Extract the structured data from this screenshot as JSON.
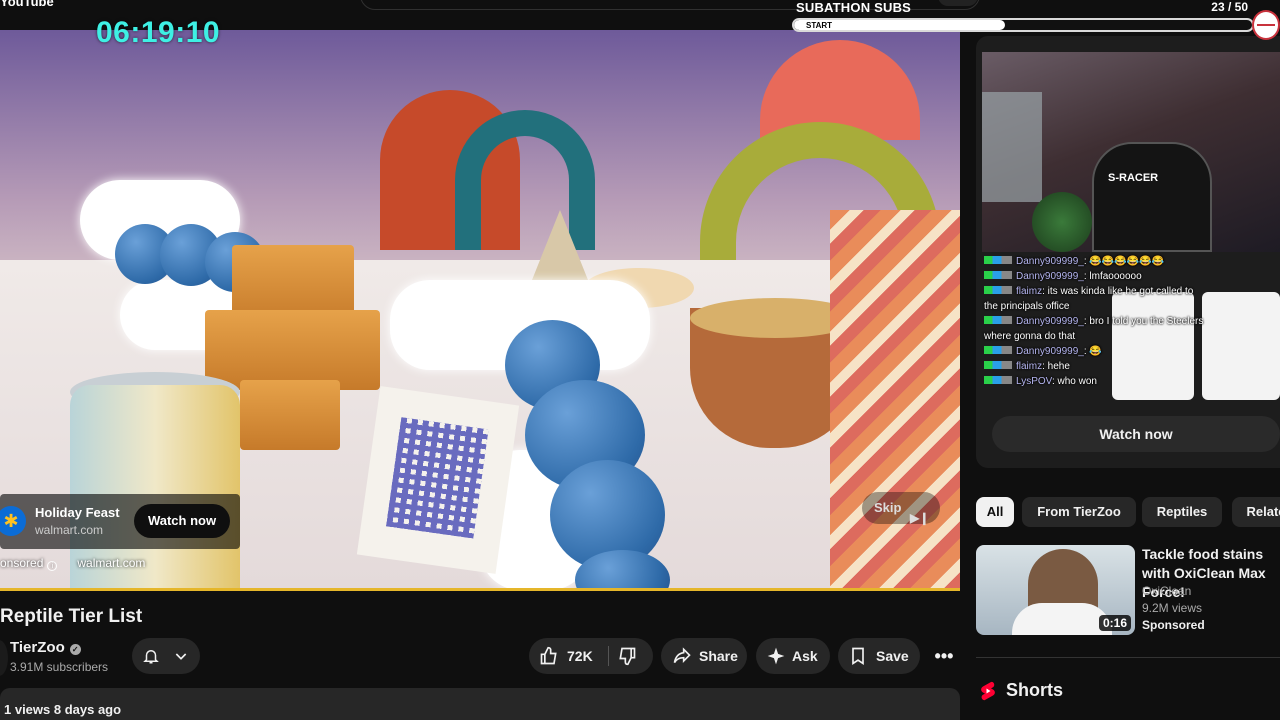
{
  "top": {
    "logo_text": "YouTube"
  },
  "overlay": {
    "timer": "06:19:10",
    "subathon_label": "SUBATHON SUBS",
    "start_label": "START",
    "count": "23  / 50",
    "progress_fraction": 0.46
  },
  "ad": {
    "title": "Holiday Feast",
    "domain": "walmart.com",
    "watch_label": "Watch now",
    "sponsored_label": "onsored",
    "sponsored_domain": "walmart.com",
    "skip_label": "Skip"
  },
  "video": {
    "title": "Reptile Tier List",
    "channel": "TierZoo",
    "subscribers": "3.91M subscribers",
    "likes": "72K",
    "share_label": "Share",
    "ask_label": "Ask",
    "save_label": "Save",
    "views_line": "1 views  8 days ago"
  },
  "live": {
    "cam_label": "S-RACER",
    "chat": [
      {
        "user": "Danny909999_",
        "msg": ": 😂😂😂😂😂😂"
      },
      {
        "user": "Danny909999_",
        "msg": ": lmfaoooooo"
      },
      {
        "user": "flaimz",
        "msg": ": its was kinda like he got called to the principals office"
      },
      {
        "user": "Danny909999_",
        "msg": ": bro I told you the Steelers where gonna do that"
      },
      {
        "user": "Danny909999_",
        "msg": ": 😂"
      },
      {
        "user": "flaimz",
        "msg": ": hehe"
      },
      {
        "user": "LysPOV",
        "msg": ": who won"
      }
    ],
    "watch_now": "Watch now"
  },
  "chips": [
    "All",
    "From TierZoo",
    "Reptiles",
    "Related"
  ],
  "recommendation": {
    "title": "Tackle food stains with OxiClean Max Force!",
    "channel": "OxiClean",
    "views": "9.2M views",
    "sponsored": "Sponsored",
    "duration": "0:16"
  },
  "shorts": {
    "label": "Shorts"
  },
  "colors": {
    "accent": "#ff0033",
    "timer": "#3ef0e4",
    "progress": "#e5b62a",
    "page_bg": "#0f0f0f"
  }
}
